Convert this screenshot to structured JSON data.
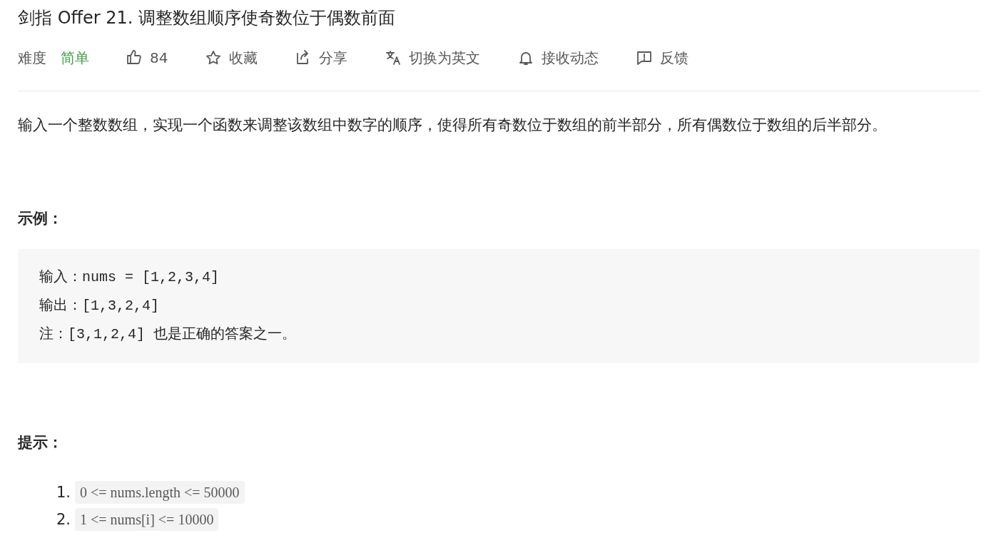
{
  "title": "剑指 Offer 21. 调整数组顺序使奇数位于偶数前面",
  "toolbar": {
    "difficulty_label": "难度",
    "difficulty": "简单",
    "items": [
      {
        "kind": "like",
        "label": "84"
      },
      {
        "kind": "star",
        "label": "收藏"
      },
      {
        "kind": "share",
        "label": "分享"
      },
      {
        "kind": "translate",
        "label": "切换为英文"
      },
      {
        "kind": "bell",
        "label": "接收动态"
      },
      {
        "kind": "feedback",
        "label": "反馈"
      }
    ]
  },
  "description": "输入一个整数数组，实现一个函数来调整该数组中数字的顺序，使得所有奇数位于数组的前半部分，所有偶数位于数组的后半部分。",
  "example": {
    "heading": "示例：",
    "lines": [
      "输入：nums = [1,2,3,4]",
      "输出：[1,3,2,4]",
      "注：[3,1,2,4] 也是正确的答案之一。"
    ]
  },
  "hints": {
    "heading": "提示：",
    "items": [
      {
        "number": "1.",
        "code": "0 <= nums.length <= 50000"
      },
      {
        "number": "2.",
        "code": "1 <= nums[i] <= 10000"
      }
    ]
  }
}
